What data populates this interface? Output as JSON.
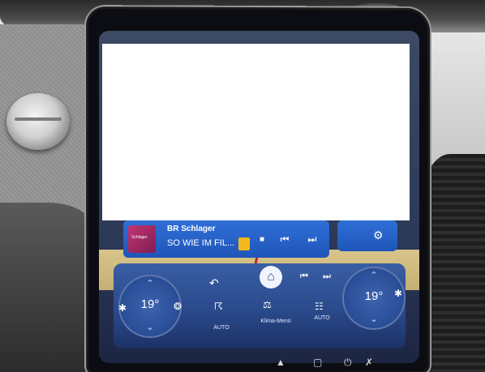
{
  "media": {
    "station": "BR Schlager",
    "song": "SO WIE IM FIL...",
    "cover_text": "Schlager",
    "prev_icon": "skip-previous-icon",
    "next_icon": "skip-next-icon"
  },
  "climate": {
    "left_temp": "19°",
    "right_temp": "19°",
    "left_auto_label": "AUTO",
    "right_auto_label": "AUTO",
    "menu_label": "Klima-Menü"
  },
  "colors": {
    "tile_blue": "#2f6fd8",
    "climate_blue": "#2a4a8c",
    "pin_yellow": "#f5b81c"
  }
}
